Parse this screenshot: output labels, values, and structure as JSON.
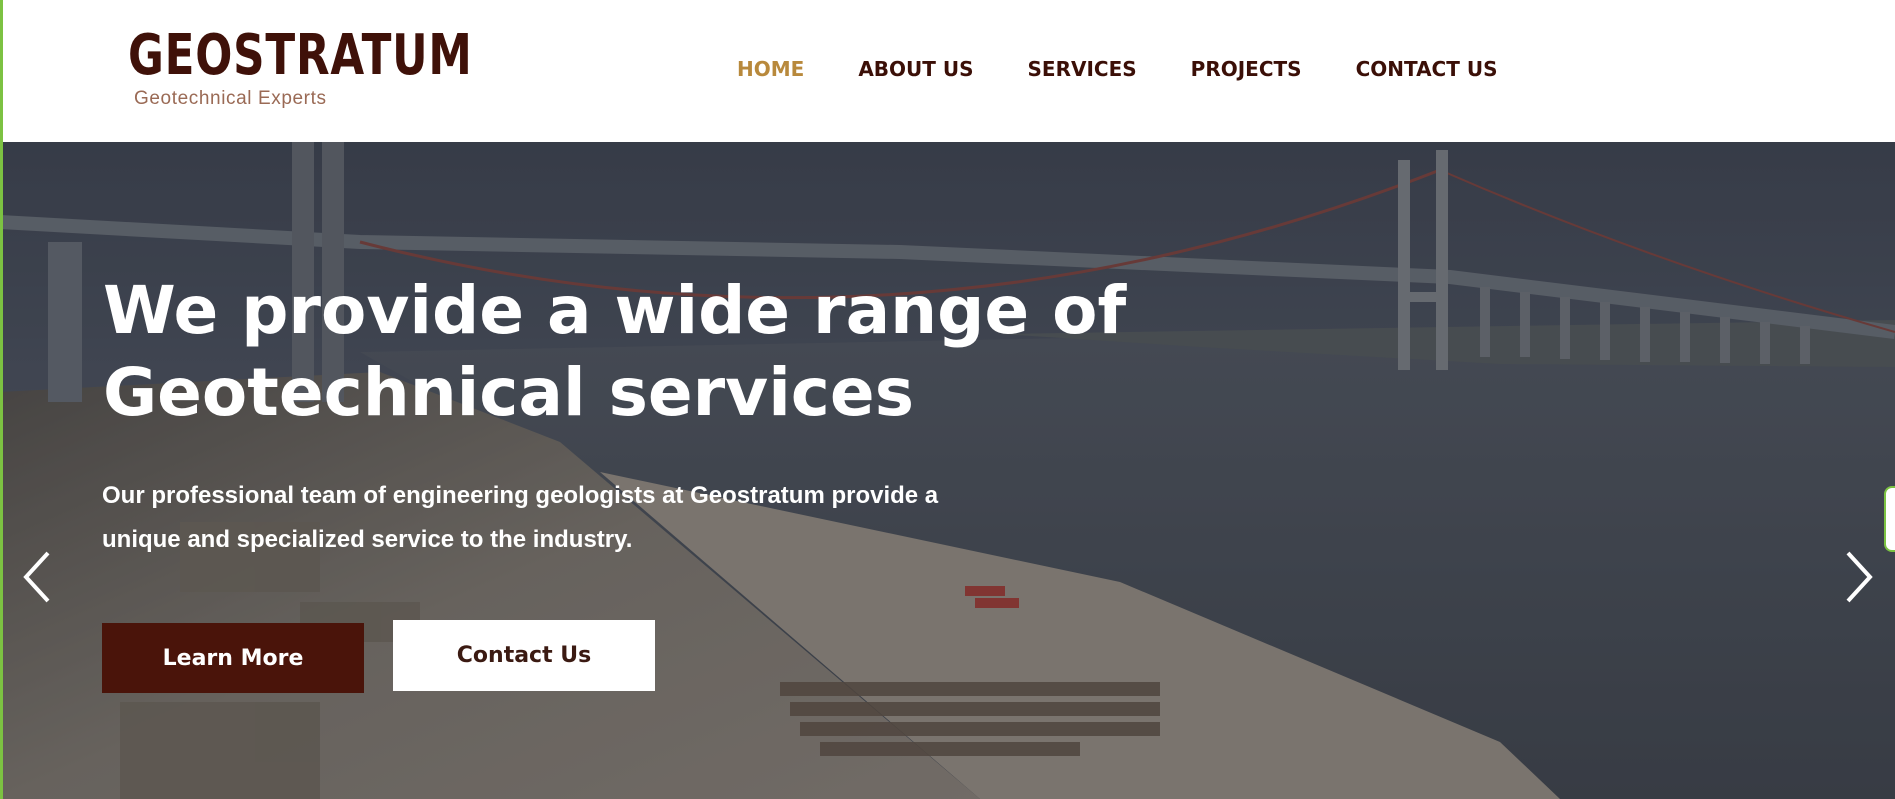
{
  "brand": {
    "name": "GEOSTRATUM",
    "tagline": "Geotechnical Experts"
  },
  "nav": {
    "items": [
      {
        "label": "HOME",
        "active": true
      },
      {
        "label": "ABOUT US",
        "active": false
      },
      {
        "label": "SERVICES",
        "active": false
      },
      {
        "label": "PROJECTS",
        "active": false
      },
      {
        "label": "CONTACT US",
        "active": false
      }
    ]
  },
  "hero": {
    "title_line1": "We provide a wide range of",
    "title_line2": "Geotechnical services",
    "subtitle": "Our professional team of engineering geologists at Geostratum provide a unique and specialized service to the industry.",
    "primary_button": "Learn More",
    "secondary_button": "Contact Us",
    "background_image": "suspension-bridge-construction-site-photo",
    "prev_icon": "chevron-left-icon",
    "next_icon": "chevron-right-icon"
  },
  "colors": {
    "brand_dark": "#4a140a",
    "nav_active": "#b8893c",
    "nav_text": "#3b0f07",
    "accent_edge": "#7cc242"
  }
}
